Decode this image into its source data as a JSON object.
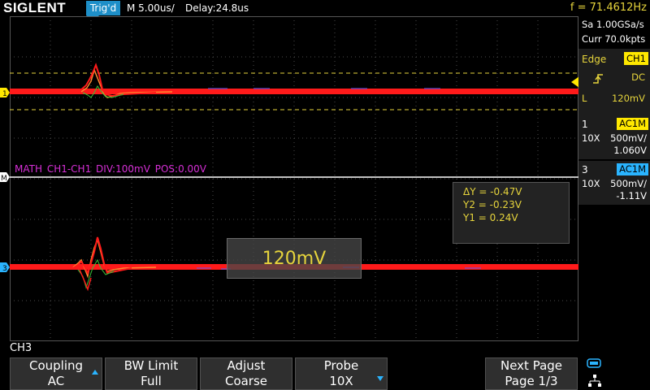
{
  "header": {
    "brand": "SIGLENT",
    "trigger_status": "Trig'd",
    "timebase": "M 5.00us/",
    "delay": "Delay:24.8us",
    "frequency": "f = 71.4612Hz"
  },
  "acquisition": {
    "sample_rate": "Sa 1.00GSa/s",
    "memory": "Curr 70.0kpts"
  },
  "trigger": {
    "type": "Edge",
    "source": "CH1",
    "coupling": "DC",
    "level_label": "L",
    "level": "120mV"
  },
  "channels": [
    {
      "num": "1",
      "coupling": "AC1M",
      "probe": "10X",
      "scale": "500mV/",
      "offset": "1.060V",
      "color": "#ffe800"
    },
    {
      "num": "3",
      "coupling": "AC1M",
      "probe": "10X",
      "scale": "500mV/",
      "offset": "-1.11V",
      "color": "#2ab4ff"
    }
  ],
  "math": {
    "label": "MATH",
    "expr": "CH1-CH1",
    "div": "DIV:100mV",
    "pos": "POS:0.00V",
    "color": "#d62fd6"
  },
  "cursors": {
    "dy": "ΔY = -0.47V",
    "y2": "Y2 = -0.23V",
    "y1": "Y1 = 0.24V"
  },
  "markers": {
    "ch1": "1",
    "math": "M",
    "ch3": "3"
  },
  "popup_value": "120mV",
  "menu_title": "CH3",
  "softkeys": [
    {
      "line1": "Coupling",
      "line2": "AC"
    },
    {
      "line1": "BW Limit",
      "line2": "Full"
    },
    {
      "line1": "Adjust",
      "line2": "Coarse"
    },
    {
      "line1": "Probe",
      "line2": "10X"
    },
    {
      "line1": "Next Page",
      "line2": "Page 1/3"
    }
  ],
  "colors": {
    "trace": "#ff1a1a",
    "ch1": "#ffe800",
    "ch3": "#2ab4ff",
    "trigger_accent": "#1e8fc8",
    "text_yellow": "#e6d43c"
  },
  "icons": [
    "trigger-rising-edge-icon",
    "usb-icon",
    "network-icon"
  ]
}
